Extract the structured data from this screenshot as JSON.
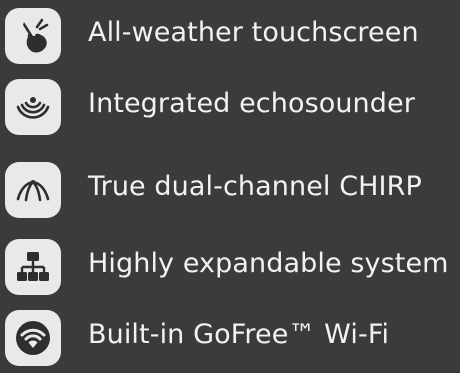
{
  "features": [
    {
      "icon": "touch-hand-icon",
      "label": "All-weather touchscreen"
    },
    {
      "icon": "sonar-waves-icon",
      "label": "Integrated echosounder"
    },
    {
      "icon": "chirp-beams-icon",
      "label": "True dual-channel CHIRP"
    },
    {
      "icon": "network-icon",
      "label": "Highly expandable system"
    },
    {
      "icon": "wifi-icon",
      "label": "Built-in GoFree™  Wi-Fi"
    }
  ],
  "colors": {
    "background": "#3b3b3d",
    "icon_badge": "#e9e9ea",
    "icon_glyph": "#2e2e30",
    "text": "#f2f2f2"
  }
}
